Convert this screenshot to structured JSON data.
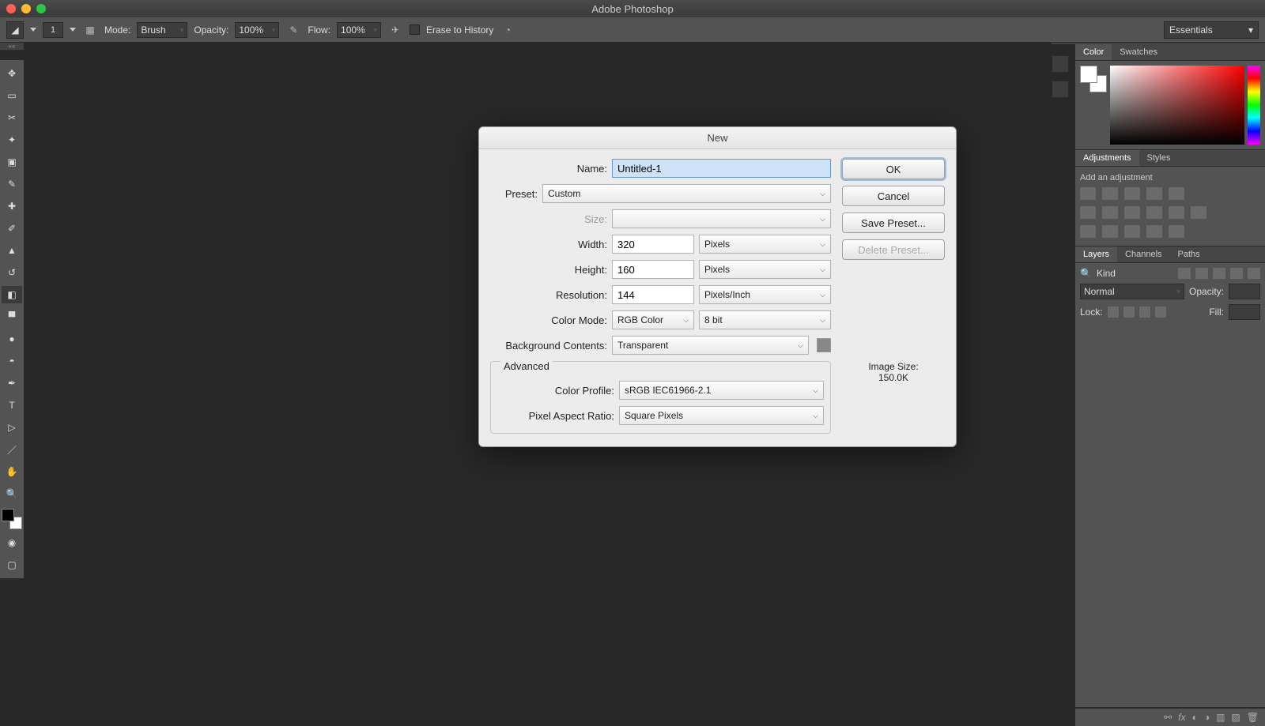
{
  "app": {
    "title": "Adobe Photoshop"
  },
  "optionsBar": {
    "sizeValue": "1",
    "modeLabel": "Mode:",
    "modeValue": "Brush",
    "opacityLabel": "Opacity:",
    "opacityValue": "100%",
    "flowLabel": "Flow:",
    "flowValue": "100%",
    "eraseLabel": "Erase to History",
    "workspace": "Essentials"
  },
  "panels": {
    "colorTab": "Color",
    "swatchesTab": "Swatches",
    "adjustmentsTab": "Adjustments",
    "stylesTab": "Styles",
    "addAdjLabel": "Add an adjustment",
    "layersTab": "Layers",
    "channelsTab": "Channels",
    "pathsTab": "Paths",
    "layerKind": "Kind",
    "layerBlend": "Normal",
    "layerOpacityLbl": "Opacity:",
    "layerLockLbl": "Lock:",
    "layerFillLbl": "Fill:"
  },
  "dialog": {
    "title": "New",
    "nameLabel": "Name:",
    "nameValue": "Untitled-1",
    "presetLabel": "Preset:",
    "presetValue": "Custom",
    "sizeLabel": "Size:",
    "sizeValue": "",
    "widthLabel": "Width:",
    "widthValue": "320",
    "widthUnit": "Pixels",
    "heightLabel": "Height:",
    "heightValue": "160",
    "heightUnit": "Pixels",
    "resLabel": "Resolution:",
    "resValue": "144",
    "resUnit": "Pixels/Inch",
    "colorModeLabel": "Color Mode:",
    "colorModeValue": "RGB Color",
    "colorDepthValue": "8 bit",
    "bgLabel": "Background Contents:",
    "bgValue": "Transparent",
    "advancedLegend": "Advanced",
    "profileLabel": "Color Profile:",
    "profileValue": "sRGB IEC61966-2.1",
    "pixelAspectLabel": "Pixel Aspect Ratio:",
    "pixelAspectValue": "Square Pixels",
    "okLabel": "OK",
    "cancelLabel": "Cancel",
    "savePresetLabel": "Save Preset...",
    "deletePresetLabel": "Delete Preset...",
    "imageSizeLabel": "Image Size:",
    "imageSizeValue": "150.0K"
  }
}
